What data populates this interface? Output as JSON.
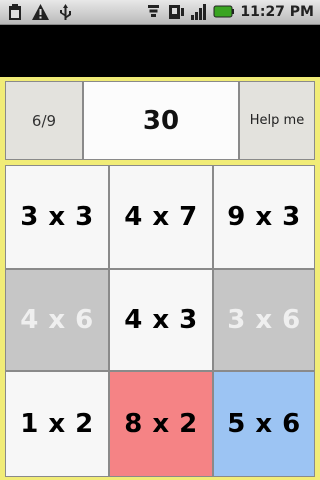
{
  "status_bar": {
    "time": "11:27 PM",
    "icons": [
      "clipboard-icon",
      "warning-icon",
      "usb-icon",
      "wifi-icon",
      "sim-icon",
      "signal-icon",
      "battery-icon"
    ]
  },
  "game": {
    "progress": "6/9",
    "target": "30",
    "help_label": "Help me",
    "tiles": [
      {
        "label": "3 x 3",
        "state": "normal"
      },
      {
        "label": "4 x 7",
        "state": "normal"
      },
      {
        "label": "9 x 3",
        "state": "normal"
      },
      {
        "label": "4 x 6",
        "state": "used"
      },
      {
        "label": "4 x 3",
        "state": "normal"
      },
      {
        "label": "3 x 6",
        "state": "used"
      },
      {
        "label": "1 x 2",
        "state": "normal"
      },
      {
        "label": "8 x 2",
        "state": "selected-red"
      },
      {
        "label": "5 x 6",
        "state": "selected-blue"
      }
    ]
  },
  "colors": {
    "panel_background": "#f1ec77",
    "tile_normal": "#f7f7f7",
    "tile_used": "#c6c6c6",
    "tile_red": "#f58385",
    "tile_blue": "#9cc4f3"
  }
}
